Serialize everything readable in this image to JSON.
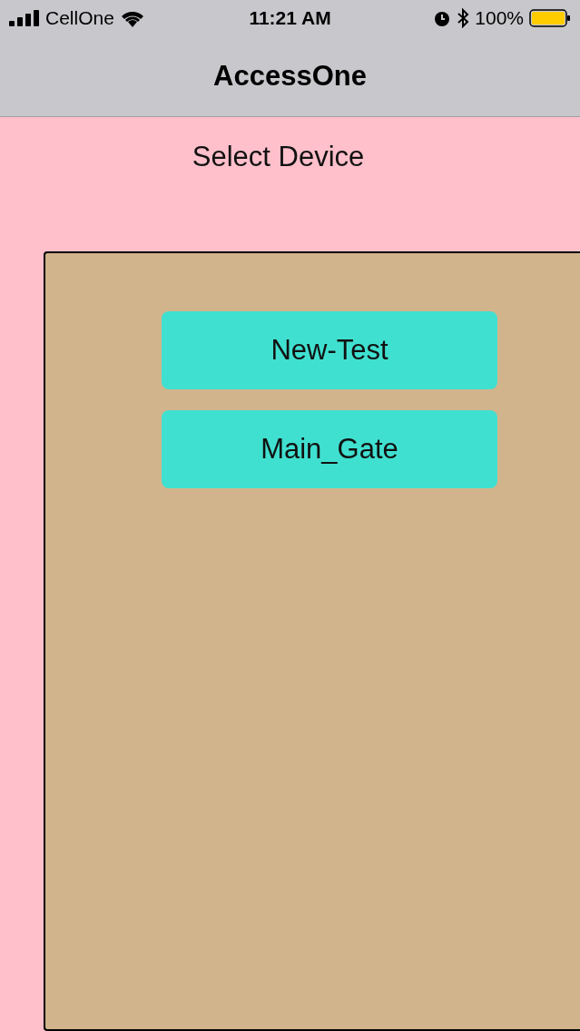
{
  "status_bar": {
    "carrier": "CellOne",
    "time": "11:21 AM",
    "battery": "100%"
  },
  "nav_bar": {
    "title": "AccessOne"
  },
  "heading": "Select Device",
  "devices": [
    {
      "label": "New-Test"
    },
    {
      "label": "Main_Gate"
    }
  ]
}
